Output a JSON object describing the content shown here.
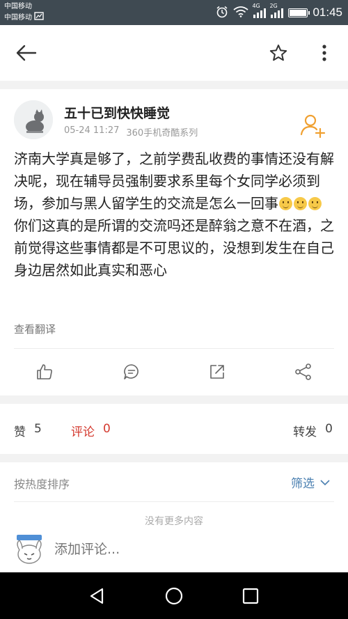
{
  "status_bar": {
    "carrier_1": "中国移动",
    "carrier_2": "中国移动",
    "time": "01:45",
    "net_1": "4G",
    "net_2": "2G"
  },
  "post": {
    "username": "五十已到快快睡觉",
    "date": "05-24 11:27",
    "source": "360手机奇酷系列",
    "text_before_emoji": "济南大学真是够了，之前学费乱收费的事情还没有解决呢，现在辅导员强制要求系里每个女同学必须到场，参加与黑人留学生的交流是怎么一回事",
    "text_after_emoji": "你们这真的是所谓的交流吗还是醉翁之意不在酒，之前觉得这些事情都是不可思议的，没想到发生在自己身边居然如此真实和恶心",
    "translate_link": "查看翻译"
  },
  "stats": {
    "like_label": "赞",
    "like_count": "5",
    "comment_label": "评论",
    "comment_count": "0",
    "repost_label": "转发",
    "repost_count": "0"
  },
  "comments": {
    "sort_label": "按热度排序",
    "filter_label": "筛选",
    "empty_text": "没有更多内容",
    "input_placeholder": "添加评论..."
  },
  "icons": {
    "back": "back-arrow-icon",
    "favorite": "star-icon",
    "more": "more-vertical-icon",
    "follow": "add-user-icon",
    "like": "thumbs-up-icon",
    "comment": "comment-bubble-icon",
    "repost": "share-external-icon",
    "share": "share-nodes-icon",
    "nav_back": "nav-back-triangle-icon",
    "nav_home": "nav-home-circle-icon",
    "nav_recent": "nav-recent-square-icon"
  },
  "colors": {
    "status_bar": "#3f4a52",
    "follow_icon": "#f0a030",
    "comment_active": "#d43a2f",
    "filter_link": "#4a7fb0"
  },
  "battery_level": 1.0
}
